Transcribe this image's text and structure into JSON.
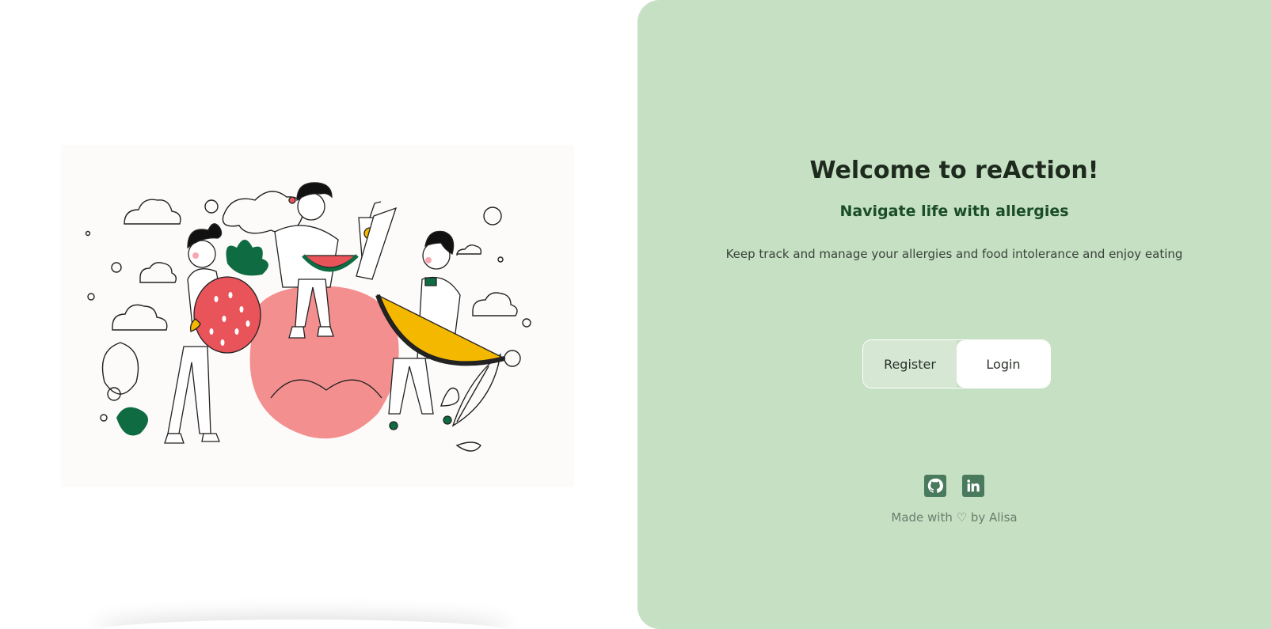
{
  "hero": {
    "title": "Welcome to reAction!",
    "subtitle": "Navigate life with allergies",
    "description": "Keep track and manage your allergies and food intolerance and enjoy eating"
  },
  "auth": {
    "register_label": "Register",
    "login_label": "Login",
    "selected": "Login"
  },
  "socials": [
    {
      "icon": "github-icon"
    },
    {
      "icon": "linkedin-icon"
    }
  ],
  "footer": {
    "text": "Made with ♡ by Alisa"
  },
  "colors": {
    "panel_bg": "#c5e0c3",
    "accent_dark_green": "#1b4d2b",
    "icon_green": "#4a7a5e",
    "strawberry": "#e8545a",
    "orange": "#f5b800"
  }
}
